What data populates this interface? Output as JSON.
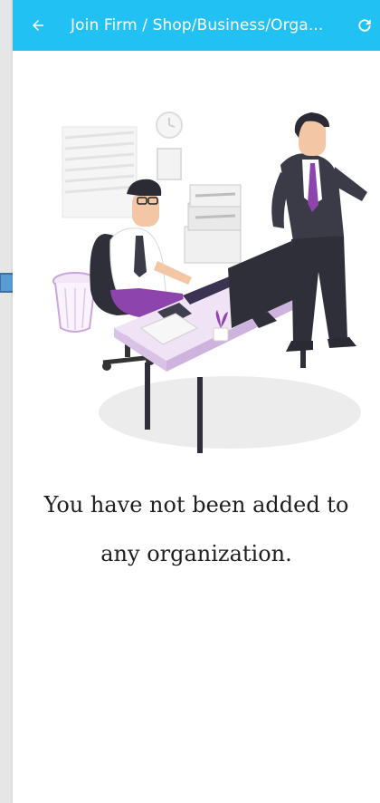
{
  "app_bar": {
    "title": "Join Firm / Shop/Business/Orga...",
    "back_icon": "arrow-left-icon",
    "refresh_icon": "refresh-icon",
    "background_color": "#21c2f3"
  },
  "illustration": {
    "name": "office-workers-illustration",
    "accent_color": "#8e44ad",
    "desk_color": "#e8d5f0"
  },
  "empty_state": {
    "line1": "You have not been added to",
    "line2": "any organization."
  },
  "pointer": {
    "icon": "pointer-arrow-icon",
    "color": "#5b9bd5"
  }
}
